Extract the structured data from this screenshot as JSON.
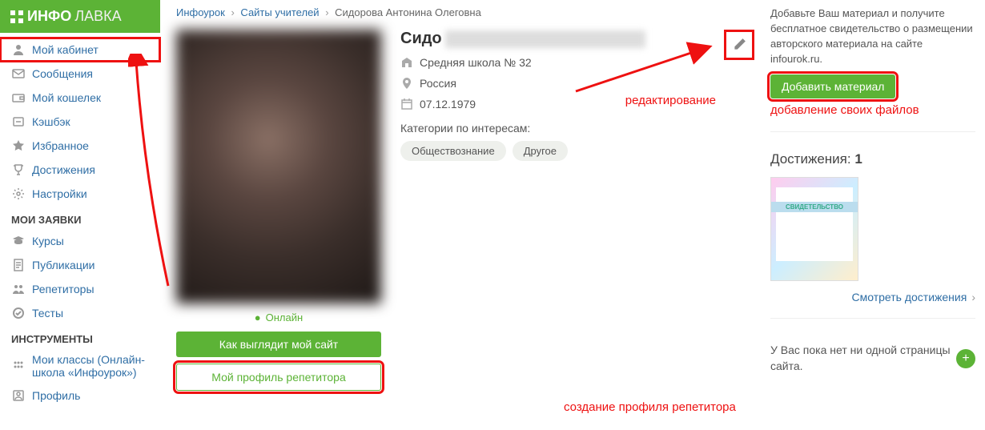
{
  "logo": {
    "part1": "ИНФО",
    "part2": "ЛАВКА"
  },
  "sidebar": {
    "items": [
      {
        "label": "Мой кабинет",
        "icon": "user"
      },
      {
        "label": "Сообщения",
        "icon": "mail"
      },
      {
        "label": "Мой кошелек",
        "icon": "wallet"
      },
      {
        "label": "Кэшбэк",
        "icon": "cashback"
      },
      {
        "label": "Избранное",
        "icon": "star"
      },
      {
        "label": "Достижения",
        "icon": "trophy"
      },
      {
        "label": "Настройки",
        "icon": "gear"
      }
    ],
    "section1_title": "МОИ ЗАЯВКИ",
    "section1_items": [
      {
        "label": "Курсы",
        "icon": "grad"
      },
      {
        "label": "Публикации",
        "icon": "doc"
      },
      {
        "label": "Репетиторы",
        "icon": "people"
      },
      {
        "label": "Тесты",
        "icon": "check"
      }
    ],
    "section2_title": "ИНСТРУМЕНТЫ",
    "section2_items": [
      {
        "label": "Мои классы (Онлайн-школа «Инфоурок»)",
        "icon": "group"
      },
      {
        "label": "Профиль",
        "icon": "profile"
      }
    ]
  },
  "breadcrumb": {
    "a": "Инфоурок",
    "b": "Сайты учителей",
    "c": "Сидорова Антонина Олеговна"
  },
  "profile": {
    "name_prefix": "Сидо",
    "school": "Средняя школа № 32",
    "country": "Россия",
    "birthdate": "07.12.1979",
    "categories_label": "Категории по интересам:",
    "tags": [
      "Обществознание",
      "Другое"
    ],
    "online": "Онлайн",
    "btn_preview": "Как выглядит мой сайт",
    "btn_tutor": "Мой профиль репетитора"
  },
  "annotations": {
    "edit": "редактирование",
    "tutor": "создание профиля репетитора",
    "add_files": "добавление своих файлов"
  },
  "right": {
    "promo": "Добавьте Ваш материал и получите бесплатное свидетельство о размещении авторского материала на сайте infourok.ru.",
    "add_btn": "Добавить материал",
    "achieve_title": "Достижения:",
    "achieve_count": "1",
    "achieve_link": "Смотреть достижения",
    "site_note": "У Вас пока нет ни одной страницы сайта."
  }
}
